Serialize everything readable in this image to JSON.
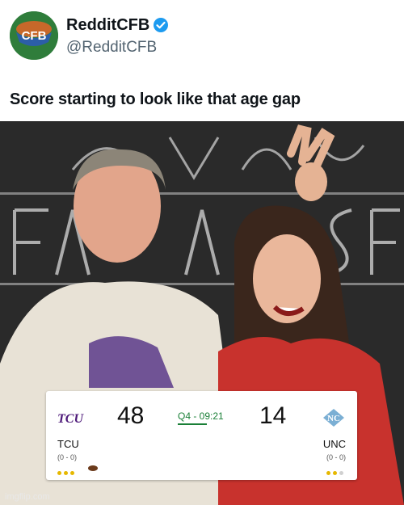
{
  "account": {
    "name": "RedditCFB",
    "handle": "@RedditCFB",
    "avatar_text": "CFB",
    "verified_icon": "verified-badge-icon"
  },
  "tweet": {
    "text": "Score starting to look like that age gap"
  },
  "photo": {
    "watermark": "imgflip.com"
  },
  "scoreboard": {
    "home": {
      "logo": "TCU",
      "abbr": "TCU",
      "score": "48",
      "record": "(0 - 0)",
      "timeouts_remaining": 3,
      "possession": true
    },
    "away": {
      "logo": "NC",
      "abbr": "UNC",
      "score": "14",
      "record": "(0 - 0)",
      "timeouts_remaining": 2,
      "possession": false
    },
    "clock": "Q4 - 09:21"
  },
  "colors": {
    "verified": "#1d9bf0",
    "clock_green": "#1a7f37",
    "tcu_purple": "#4d1979",
    "unc_blue": "#7bafd4"
  }
}
